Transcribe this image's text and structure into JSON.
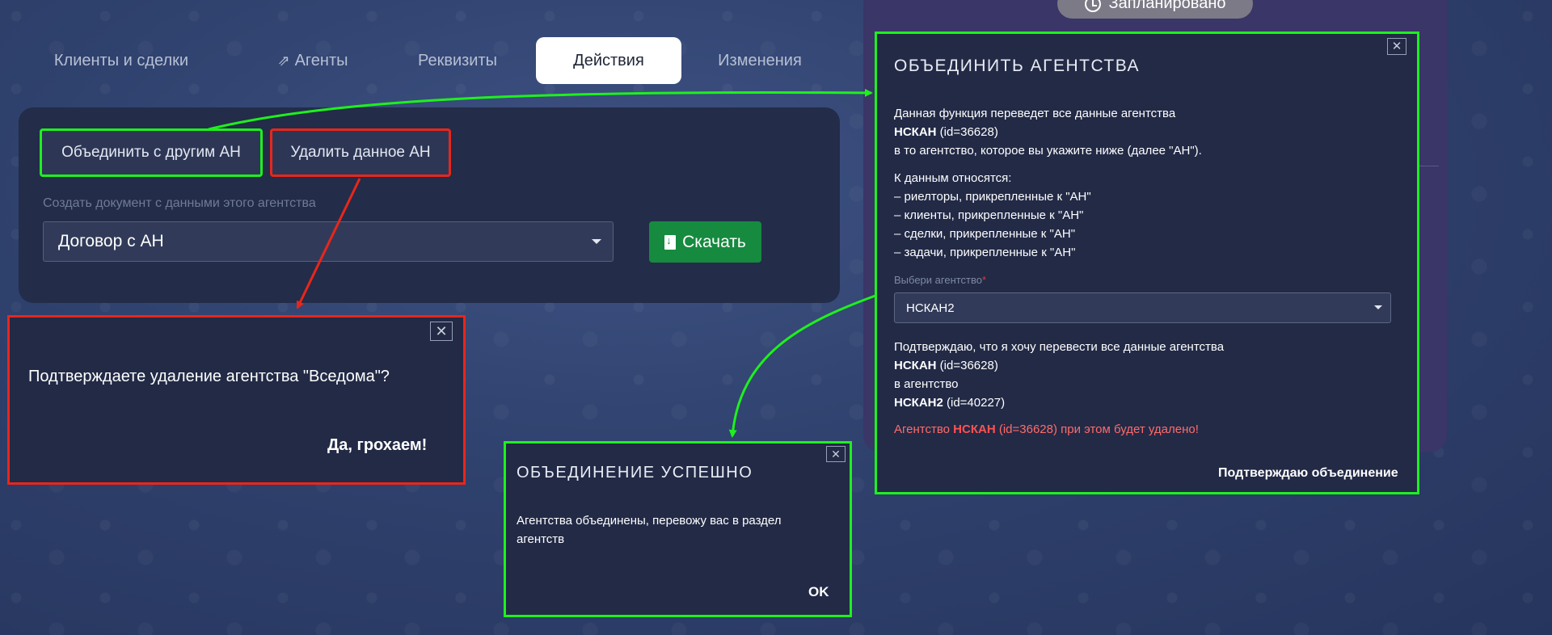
{
  "status_badge": "Запланировано",
  "tabs": [
    {
      "label": "Клиенты и сделки"
    },
    {
      "label": "Агенты"
    },
    {
      "label": "Реквизиты"
    },
    {
      "label": "Действия"
    },
    {
      "label": "Изменения"
    }
  ],
  "actions": {
    "merge_button": "Объединить с другим АН",
    "delete_button": "Удалить данное АН",
    "doc_label": "Создать документ с данными этого агентства",
    "doc_select_value": "Договор с АН",
    "download_button": "Скачать"
  },
  "delete_modal": {
    "question": "Подтверждаете удаление агентства \"Вседома\"?",
    "confirm": "Да, грохаем!"
  },
  "merge_modal": {
    "title": "ОБЪЕДИНИТЬ АГЕНТСТВА",
    "intro_line1": "Данная функция переведет все данные агентства",
    "agency_name": "НСКАН",
    "agency_id": "(id=36628)",
    "intro_line3": "в то агентство, которое вы укажите ниже (далее \"АН\").",
    "includes_heading": "К данным относятся:",
    "includes": [
      "– риелторы, прикрепленные к \"АН\"",
      "– клиенты, прикрепленные к \"АН\"",
      "– сделки, прикрепленные к \"АН\"",
      "– задачи, прикрепленные к \"АН\""
    ],
    "select_label": "Выбери агентство",
    "select_required": "*",
    "select_value": "НСКАН2",
    "confirm_line1": "Подтверждаю, что я хочу перевести все данные агентства",
    "confirm_agency": "НСКАН",
    "confirm_agency_id": "(id=36628)",
    "confirm_to": "в агентство",
    "target_agency": "НСКАН2",
    "target_agency_id": "(id=40227)",
    "warning_prefix": "Агентство",
    "warning_name": "НСКАН",
    "warning_suffix": "(id=36628) при этом будет удалено!",
    "confirm_button": "Подтверждаю объединение"
  },
  "success_modal": {
    "title": "ОБЪЕДИНЕНИЕ УСПЕШНО",
    "message": "Агентства объединены, перевожу вас в раздел агентств",
    "ok": "OK"
  },
  "colors": {
    "highlight_green": "#1ef01e",
    "highlight_red": "#e8261b",
    "download_green": "#168a3f",
    "warning_red": "#ff6b6b"
  }
}
